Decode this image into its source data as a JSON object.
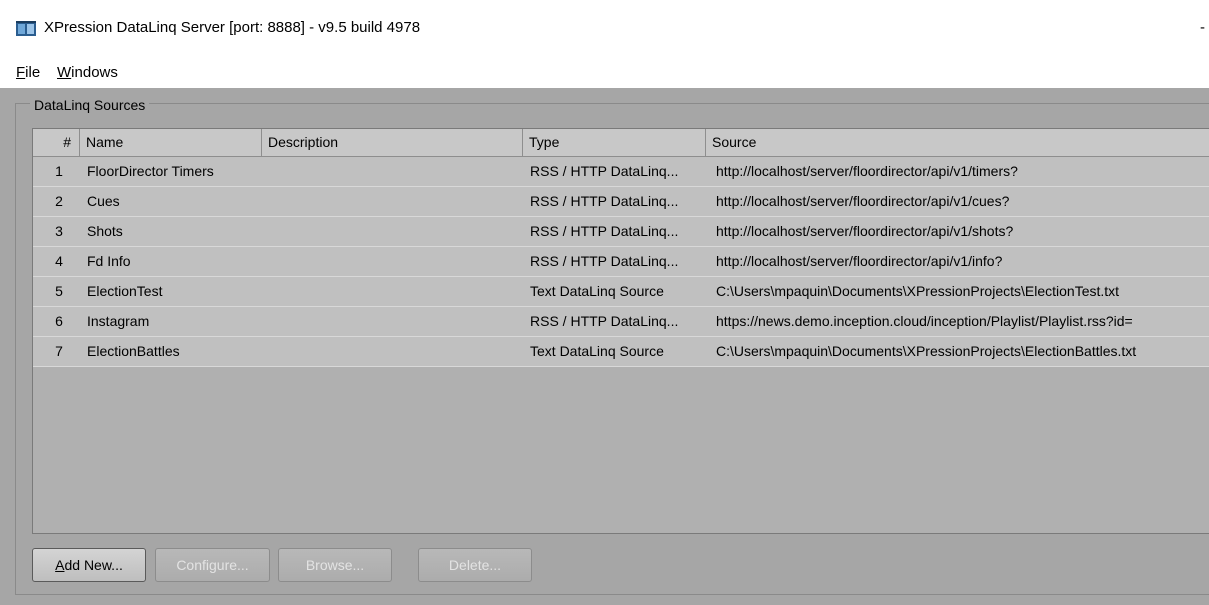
{
  "window": {
    "title": "XPression DataLinq Server [port: 8888] - v9.5 build 4978",
    "title_right": "-"
  },
  "menu": [
    {
      "label": "File"
    },
    {
      "label": "Windows"
    }
  ],
  "group": {
    "title": "DataLinq Sources"
  },
  "grid": {
    "columns": [
      "#",
      "Name",
      "Description",
      "Type",
      "Source"
    ],
    "rows": [
      {
        "num": "1",
        "name": "FloorDirector Timers",
        "description": "",
        "type": "RSS / HTTP DataLinq...",
        "source": "http://localhost/server/floordirector/api/v1/timers?"
      },
      {
        "num": "2",
        "name": "Cues",
        "description": "",
        "type": "RSS / HTTP DataLinq...",
        "source": "http://localhost/server/floordirector/api/v1/cues?"
      },
      {
        "num": "3",
        "name": "Shots",
        "description": "",
        "type": "RSS / HTTP DataLinq...",
        "source": "http://localhost/server/floordirector/api/v1/shots?"
      },
      {
        "num": "4",
        "name": "Fd Info",
        "description": "",
        "type": "RSS / HTTP DataLinq...",
        "source": "http://localhost/server/floordirector/api/v1/info?"
      },
      {
        "num": "5",
        "name": "ElectionTest",
        "description": "",
        "type": "Text DataLinq Source",
        "source": "C:\\Users\\mpaquin\\Documents\\XPressionProjects\\ElectionTest.txt"
      },
      {
        "num": "6",
        "name": "Instagram",
        "description": "",
        "type": "RSS / HTTP DataLinq...",
        "source": "https://news.demo.inception.cloud/inception/Playlist/Playlist.rss?id="
      },
      {
        "num": "7",
        "name": "ElectionBattles",
        "description": "",
        "type": "Text DataLinq Source",
        "source": "C:\\Users\\mpaquin\\Documents\\XPressionProjects\\ElectionBattles.txt"
      }
    ]
  },
  "buttons": {
    "add_new": "Add New...",
    "configure": "Configure...",
    "browse": "Browse...",
    "delete": "Delete..."
  }
}
